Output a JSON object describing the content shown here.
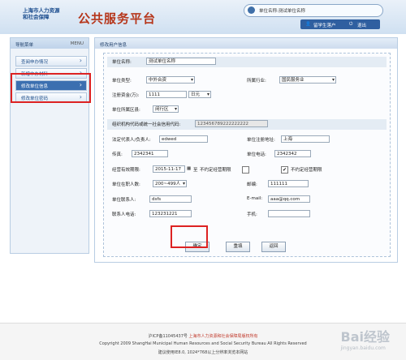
{
  "header": {
    "logo_line1": "上海市人力资源",
    "logo_line2": "和社会保障",
    "platform_title": "公共服务平台",
    "unit_name": "单位名称:测试单位名称",
    "nav_student": "留学生落户",
    "nav_logout": "退出"
  },
  "sidebar": {
    "title": "导航菜单",
    "menu": "MENU",
    "items": [
      {
        "label": "查阅申办情况"
      },
      {
        "label": "新增申办材料"
      },
      {
        "label": "修改单位信息"
      },
      {
        "label": "修改单位密码"
      }
    ]
  },
  "panel": {
    "title": "修改用户信息"
  },
  "form": {
    "unit_name_label": "单位名称:",
    "unit_name_value": "测试单位名称",
    "unit_type_label": "单位类型:",
    "unit_type_value": "中外合资",
    "industry_label": "所属行业:",
    "industry_value": "国民服务业",
    "capital_label": "注册资金(万):",
    "capital_value": "1111",
    "currency_value": "日元",
    "district_label": "单位所属区县:",
    "district_value": "闵行区",
    "credit_label": "组织机构代码或统一社会信用代码:",
    "credit_value": "123456789222222222",
    "legal_label": "法定代表人/负责人:",
    "legal_value": "edwed",
    "address_label": "单位注册地址:",
    "address_value": "上海",
    "fax_label": "传真:",
    "fax_value": "2342341",
    "phone_label": "单位电话:",
    "phone_value": "2342342",
    "period_label": "经营有效期限:",
    "period_value": "2015-11-17",
    "period_to": "至",
    "no_limit_1": "不约定经营期限",
    "no_limit_2": "不约定经营期限",
    "staff_label": "单位在职人数:",
    "staff_value": "200~499人",
    "post_label": "邮编:",
    "post_value": "111111",
    "contact_label": "单位联系人:",
    "contact_value": "dsfs",
    "email_label": "E-mail:",
    "email_value": "aaa@qq.com",
    "contact_phone_label": "联系人电话:",
    "contact_phone_value": "123231221",
    "mobile_label": "手机:",
    "mobile_value": ""
  },
  "buttons": {
    "confirm": "确定",
    "reset": "重填",
    "back": "返回"
  },
  "footer": {
    "icp": "沪ICP备11045437号",
    "org_link": "上海市人力资源和社会保障局版权所有",
    "copyright": "Copyright 2009 ShangHai Municipal Human Resources and Social Security Bureau All Rights Reserved",
    "browser": "建议使用IE8.0, 1024*768以上分辨率浏览本网站"
  },
  "watermark": {
    "text": "Bai经验",
    "sub": "jingyan.baidu.com"
  }
}
